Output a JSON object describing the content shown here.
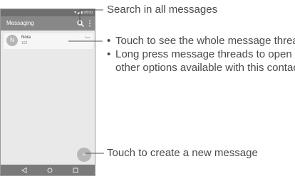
{
  "phone": {
    "status_time": "▼◢ ▮ 08:00",
    "app_title": "Messaging",
    "search_icon": "search-icon",
    "more_icon": "more-vert-icon",
    "conversation": {
      "avatar_letter": "N",
      "name": "Nora",
      "preview": "102",
      "timestamp": "Now"
    },
    "fab_symbol": "+",
    "nav": [
      "back-icon",
      "home-icon",
      "recents-icon"
    ]
  },
  "annotations": {
    "search": "Search in all messages",
    "thread_bullet_1": "Touch to see the whole message thread.",
    "thread_bullet_2_line1": "Long press message threads to open",
    "thread_bullet_2_line2": "other options available with this contact",
    "new_message": "Touch to create a new message",
    "bullet_char": "•"
  },
  "colors": {
    "screen_bg": "#e9e9e9",
    "appbar": "#888888",
    "navbar": "#7a7a7a",
    "callout_text": "#4a4a4a"
  }
}
